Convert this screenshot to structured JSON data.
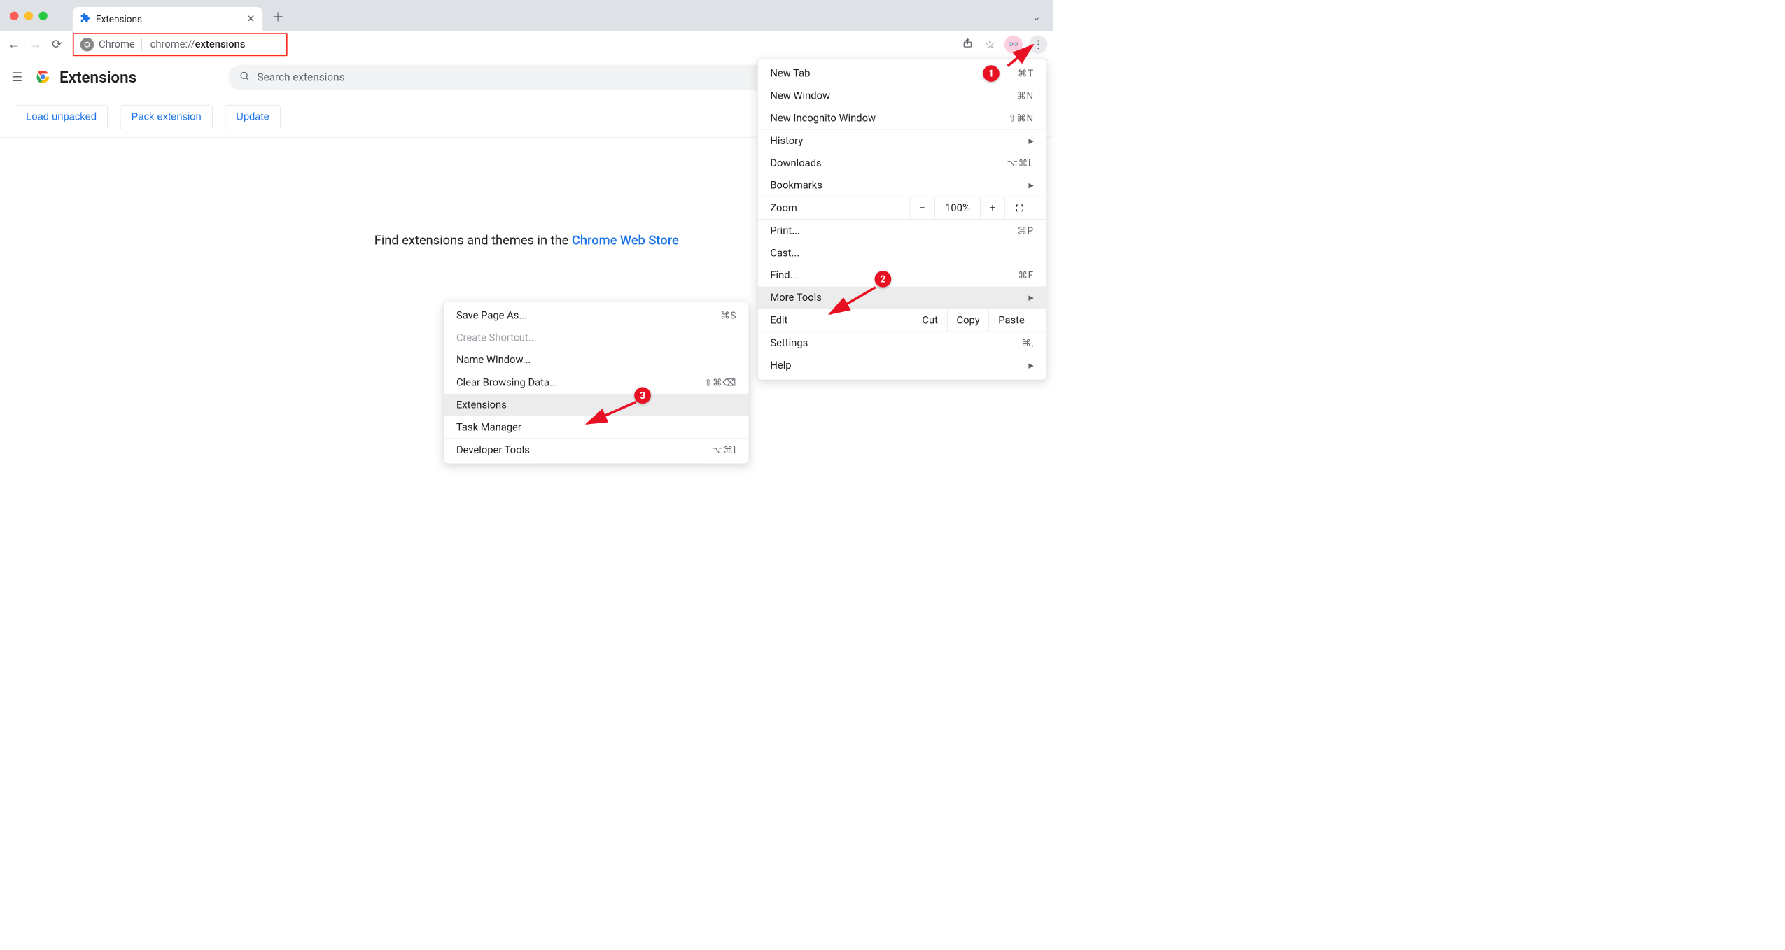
{
  "window": {
    "tab_title": "Extensions"
  },
  "toolbar": {
    "chip_label": "Chrome",
    "url_prefix": "chrome://",
    "url_path": "extensions"
  },
  "ext_page": {
    "title": "Extensions",
    "search_placeholder": "Search extensions",
    "actions": {
      "load_unpacked": "Load unpacked",
      "pack_extension": "Pack extension",
      "update": "Update"
    },
    "main_text_prefix": "Find extensions and themes in the ",
    "main_text_link": "Chrome Web Store"
  },
  "main_menu": {
    "new_tab": "New Tab",
    "new_tab_sc": "⌘T",
    "new_window": "New Window",
    "new_window_sc": "⌘N",
    "new_incognito": "New Incognito Window",
    "new_incognito_sc": "⇧⌘N",
    "history": "History",
    "downloads": "Downloads",
    "downloads_sc": "⌥⌘L",
    "bookmarks": "Bookmarks",
    "zoom": "Zoom",
    "zoom_level": "100%",
    "print": "Print...",
    "print_sc": "⌘P",
    "cast": "Cast...",
    "find": "Find...",
    "find_sc": "⌘F",
    "more_tools": "More Tools",
    "edit": "Edit",
    "cut": "Cut",
    "copy": "Copy",
    "paste": "Paste",
    "settings": "Settings",
    "settings_sc": "⌘,",
    "help": "Help"
  },
  "submenu": {
    "save_page": "Save Page As...",
    "save_page_sc": "⌘S",
    "create_shortcut": "Create Shortcut...",
    "name_window": "Name Window...",
    "clear_browsing": "Clear Browsing Data...",
    "clear_browsing_sc": "⇧⌘⌫",
    "extensions": "Extensions",
    "task_manager": "Task Manager",
    "developer_tools": "Developer Tools",
    "developer_tools_sc": "⌥⌘I"
  },
  "callouts": {
    "c1": "1",
    "c2": "2",
    "c3": "3"
  }
}
